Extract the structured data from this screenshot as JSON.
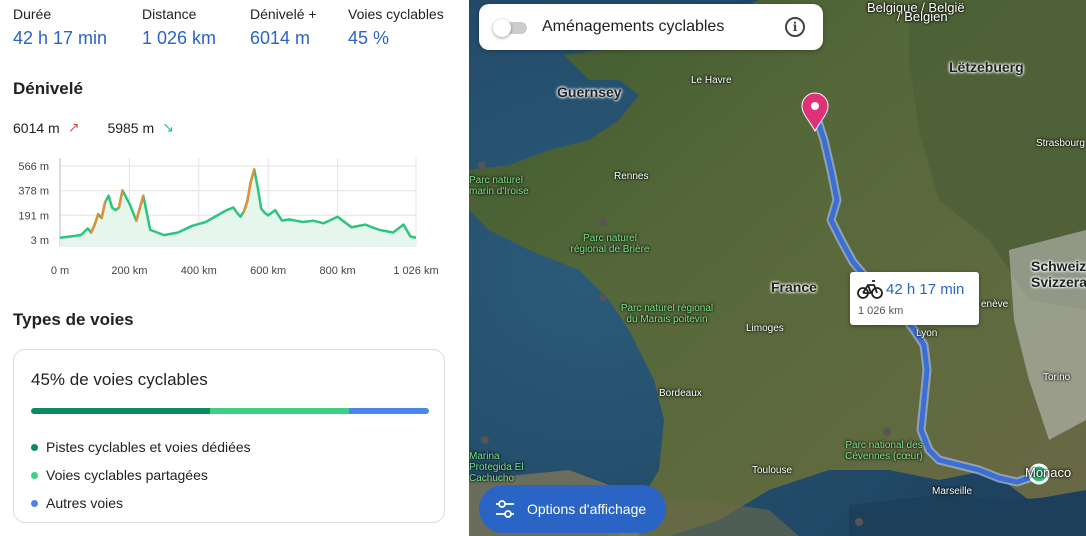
{
  "summary": {
    "duration_label": "Durée",
    "duration_value": "42 h 17 min",
    "distance_label": "Distance",
    "distance_value": "1 026 km",
    "elevation_label": "Dénivelé +",
    "elevation_value": "6014 m",
    "cycle_label": "Voies cyclables",
    "cycle_value": "45 %"
  },
  "elevation": {
    "title": "Dénivelé",
    "ascent": "6014 m",
    "descent": "5985 m",
    "ascent_icon": "arrow-up-right-icon",
    "descent_icon": "arrow-down-right-icon"
  },
  "chart_data": {
    "type": "area",
    "title": "",
    "xlabel": "",
    "ylabel": "",
    "x_ticks": [
      "0 m",
      "200 km",
      "400 km",
      "600 km",
      "800 km",
      "1 026 km"
    ],
    "y_ticks": [
      "3 m",
      "191 m",
      "378 m",
      "566 m"
    ],
    "xlim": [
      0,
      1026
    ],
    "ylim": [
      3,
      566
    ],
    "x": [
      0,
      30,
      60,
      80,
      90,
      100,
      110,
      120,
      130,
      140,
      150,
      160,
      170,
      180,
      190,
      200,
      220,
      240,
      260,
      280,
      300,
      340,
      380,
      420,
      460,
      480,
      500,
      510,
      520,
      530,
      540,
      550,
      560,
      570,
      580,
      590,
      600,
      620,
      640,
      660,
      680,
      700,
      730,
      760,
      800,
      840,
      880,
      920,
      960,
      990,
      1010,
      1026
    ],
    "values": [
      20,
      30,
      40,
      90,
      60,
      120,
      200,
      170,
      290,
      340,
      250,
      230,
      250,
      380,
      330,
      280,
      150,
      340,
      80,
      60,
      40,
      60,
      110,
      140,
      200,
      230,
      250,
      210,
      180,
      220,
      300,
      450,
      540,
      400,
      240,
      210,
      190,
      230,
      150,
      160,
      150,
      140,
      150,
      130,
      180,
      100,
      120,
      80,
      60,
      120,
      30,
      20
    ],
    "grid": true,
    "fill_color": "#e6f6ec",
    "line_color": "#2cc47e",
    "climb_color": "#e0913a"
  },
  "road_types": {
    "title": "Types de voies",
    "headline": "45% de voies cyclables",
    "segments": [
      {
        "label": "Pistes cyclables et voies dédiées",
        "color": "#0d8a5f",
        "fraction": 0.45
      },
      {
        "label": "Voies cyclables partagées",
        "color": "#3ccf86",
        "fraction": 0.35
      },
      {
        "label": "Autres voies",
        "color": "#4a86e8",
        "fraction": 0.2
      }
    ]
  },
  "map": {
    "toggle_label": "Aménagements cyclables",
    "toggle_on": false,
    "info_icon": "info-icon",
    "popup_time": "42 h 17 min",
    "popup_distance": "1 026 km",
    "popup_icon": "bicycle-icon",
    "options_button": "Options d'affichage",
    "options_icon": "sliders-icon",
    "start_marker": "map-pin-icon",
    "end_marker": "end-dot-icon",
    "route_color": "#3b6fd6",
    "places": {
      "belgique": "Belgique / België",
      "belgien": "/ Belgien",
      "luxembourg": "Lëtzebuerg",
      "guernsey": "Guernsey",
      "le_havre": "Le Havre",
      "rennes": "Rennes",
      "france": "France",
      "limoges": "Limoges",
      "bordeaux": "Bordeaux",
      "toulouse": "Toulouse",
      "marseille": "Marseille",
      "lyon": "Lyon",
      "geneve": "enève",
      "strasbourg": "Strasbourg",
      "schweiz": "Schweiz/",
      "svizzera": "Svizzera",
      "torino": "Torino",
      "monaco": "Monaco",
      "parc_iroise": "Parc naturel marin d'Iroise",
      "parc_briere": "Parc naturel régional de Brière",
      "parc_marais": "Parc naturel régional du Marais poitevin",
      "parc_cevennes": "Parc national des Cévennes (cœur)",
      "parc_cachucho": "Marina Protegida El Cachucho"
    }
  }
}
